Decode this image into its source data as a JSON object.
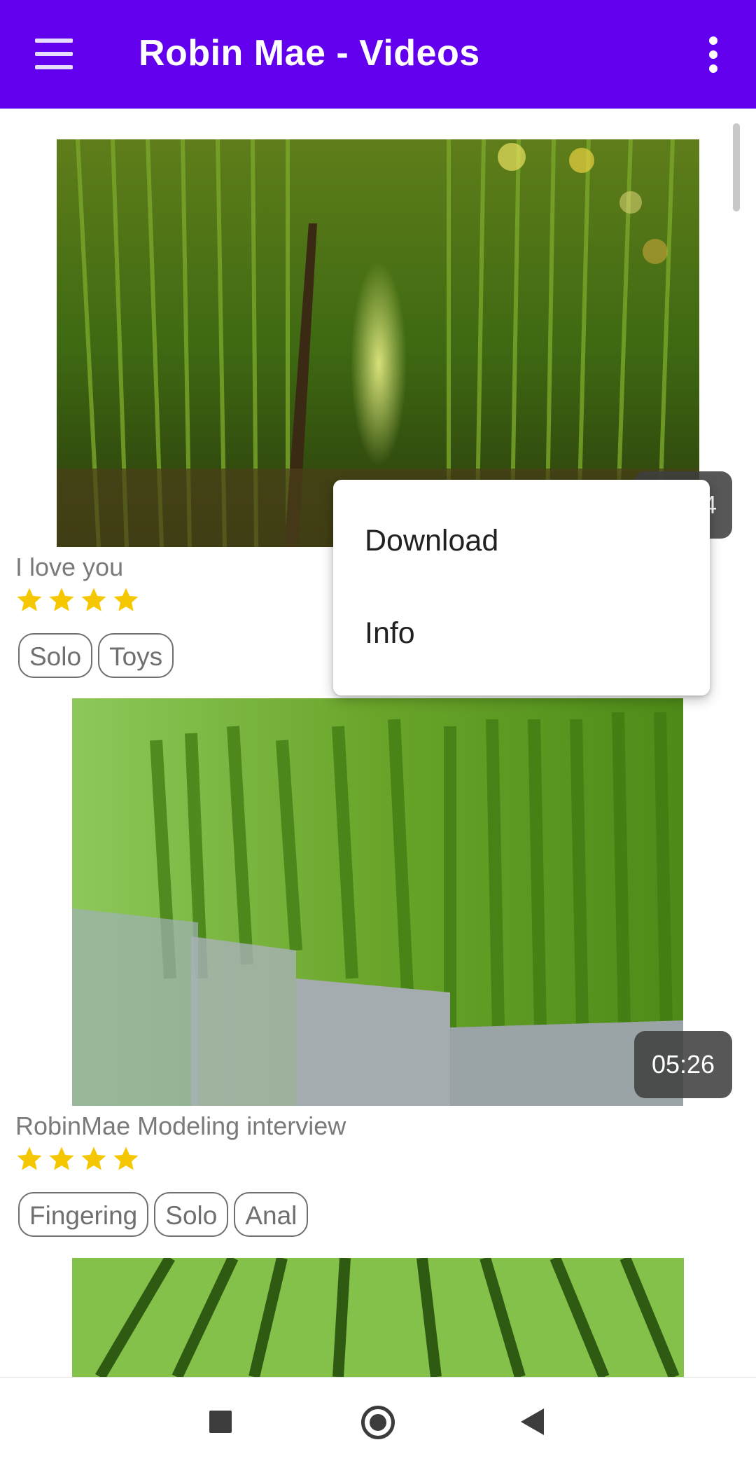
{
  "app_bar": {
    "title": "Robin Mae - Videos",
    "menu_icon": "hamburger-menu-icon",
    "overflow_icon": "more-vert-icon",
    "color": "#6200ee"
  },
  "videos": [
    {
      "title": "I love you",
      "duration": "4",
      "rating": 4,
      "tags": [
        "Solo",
        "Toys"
      ]
    },
    {
      "title": "RobinMae Modeling interview",
      "duration": "05:26",
      "rating": 4,
      "tags": [
        "Fingering",
        "Solo",
        "Anal"
      ]
    }
  ],
  "context_menu": {
    "items": [
      "Download",
      "Info"
    ]
  },
  "nav_bar": {
    "recents_icon": "square-recents-icon",
    "home_icon": "circle-home-icon",
    "back_icon": "triangle-back-icon"
  },
  "colors": {
    "star": "#f5c700",
    "tag_border": "#6f6f6f"
  }
}
